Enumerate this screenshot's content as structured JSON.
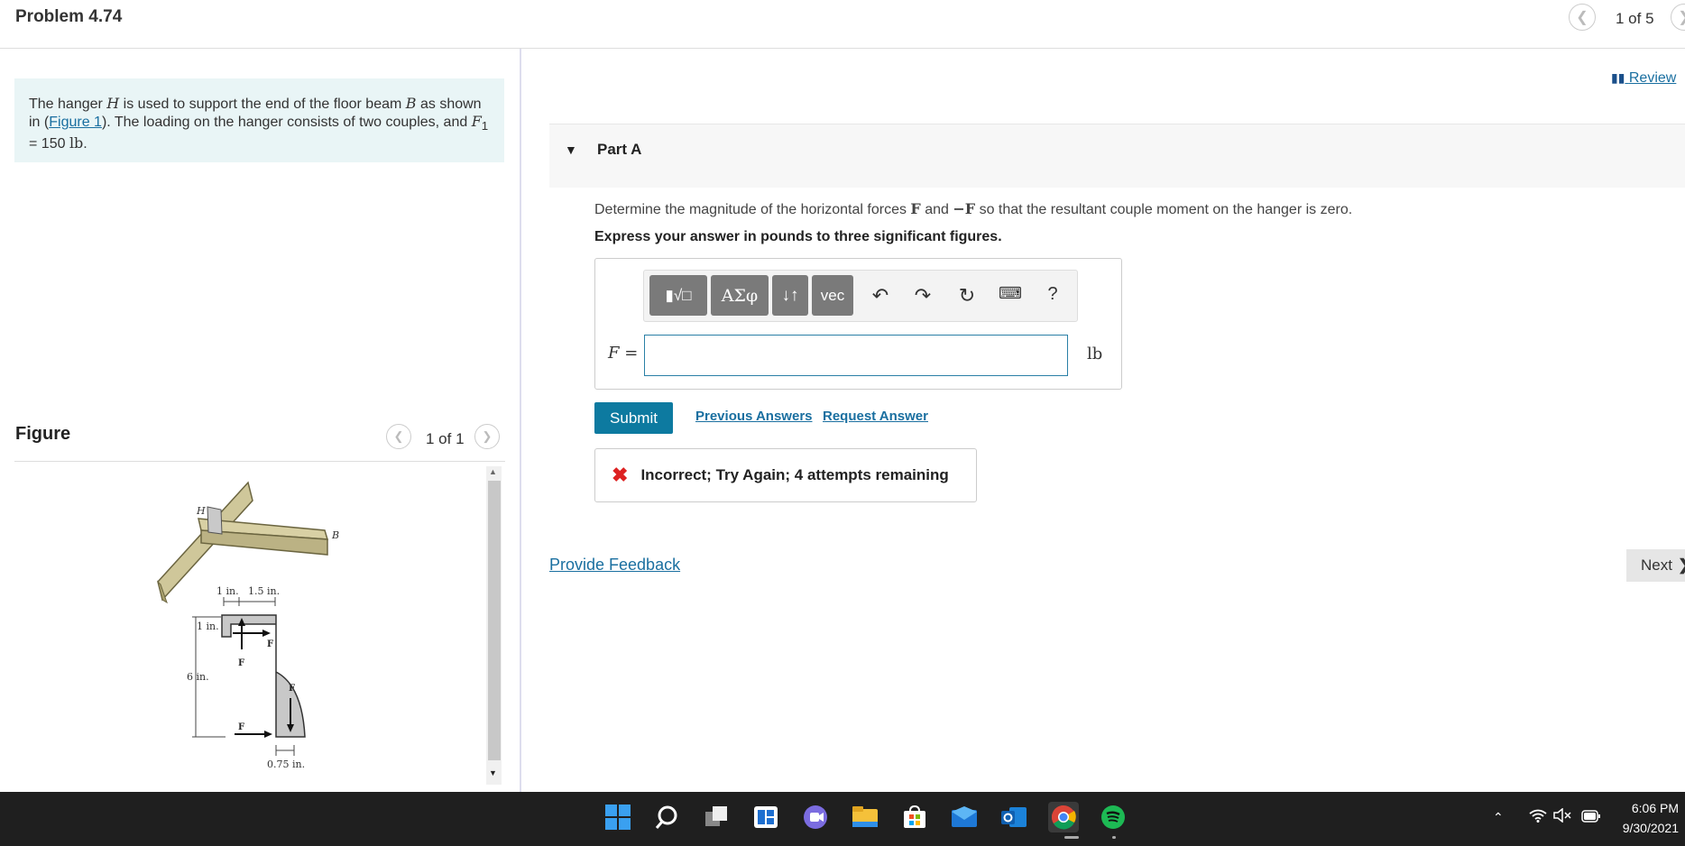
{
  "header": {
    "problem_title": "Problem 4.74",
    "pager": "1 of 5",
    "prev_icon": "chevron-left-icon"
  },
  "intro": {
    "text_before_h": "The hanger ",
    "h_symbol": "H",
    "text_after_h": " is used to support the end of the floor beam ",
    "b_symbol": "B",
    "text_as": " as shown in (",
    "figure_link": "Figure 1",
    "text_loading": "). The loading on the hanger consists of two couples, and ",
    "f1_symbol": "F",
    "f1_sub": "1",
    "f1_value": " = 150 ",
    "f1_unit": "lb",
    "period": "."
  },
  "figure": {
    "heading": "Figure",
    "pager": "1 of 1",
    "labels": {
      "h": "H",
      "b": "B",
      "dim_1in_top": "1 in.",
      "dim_15in": "1.5 in.",
      "dim_1in_side": "1 in.",
      "dim_6in": "6 in.",
      "dim_075in": "0.75 in.",
      "f_top": "F",
      "f1_top": "F",
      "f1_bottom": "F",
      "f_bottom": "F"
    }
  },
  "review": {
    "label": "Review"
  },
  "part_a": {
    "label": "Part A",
    "question_before": "Determine the magnitude of the horizontal forces ",
    "question_f": "F",
    "question_and": " and ",
    "question_negf": "−F",
    "question_after": " so that the resultant couple moment on the hanger is zero.",
    "express": "Express your answer in pounds to three significant figures.",
    "toolbar": {
      "template_label": "▮√□",
      "greek_label": "AΣφ",
      "arrows_label": "↓↑",
      "vec_label": "vec",
      "help_label": "?"
    },
    "input_label": "F =",
    "input_value": "",
    "unit": "lb",
    "submit": "Submit",
    "previous_answers": "Previous Answers",
    "request_answer": "Request Answer",
    "feedback": "Incorrect; Try Again; 4 attempts remaining",
    "provide_feedback": "Provide Feedback",
    "next": "Next"
  },
  "taskbar": {
    "time": "6:06 PM",
    "date": "9/30/2021"
  }
}
